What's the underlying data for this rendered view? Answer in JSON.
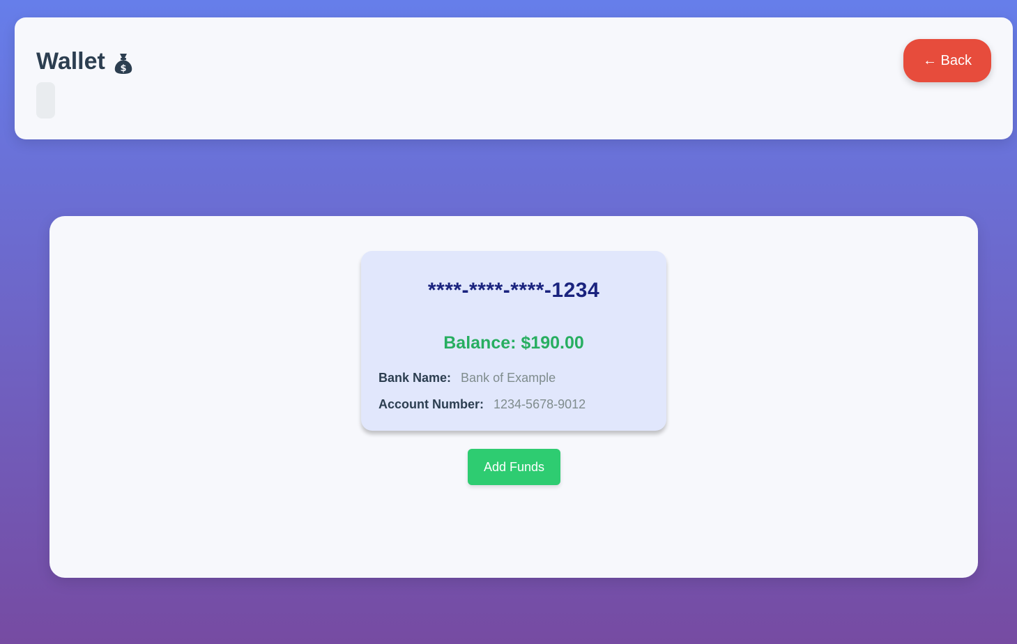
{
  "header": {
    "title": "Wallet",
    "title_icon": "money-bag-icon",
    "back_label": "← Back"
  },
  "card": {
    "number": "****-****-****-1234",
    "balance": "Balance: $190.00",
    "bank_label": "Bank Name:",
    "bank_value": "Bank of Example",
    "account_label": "Account Number:",
    "account_value": "1234-5678-9012"
  },
  "actions": {
    "add_funds_label": "Add Funds"
  },
  "colors": {
    "background_top": "#667eea",
    "background_bottom": "#764ba2",
    "back_button": "#e74c3c",
    "add_funds_button": "#2ecc71",
    "balance_text": "#27ae60",
    "card_number_text": "#1a237e",
    "card_bg": "#e1e7fc"
  }
}
